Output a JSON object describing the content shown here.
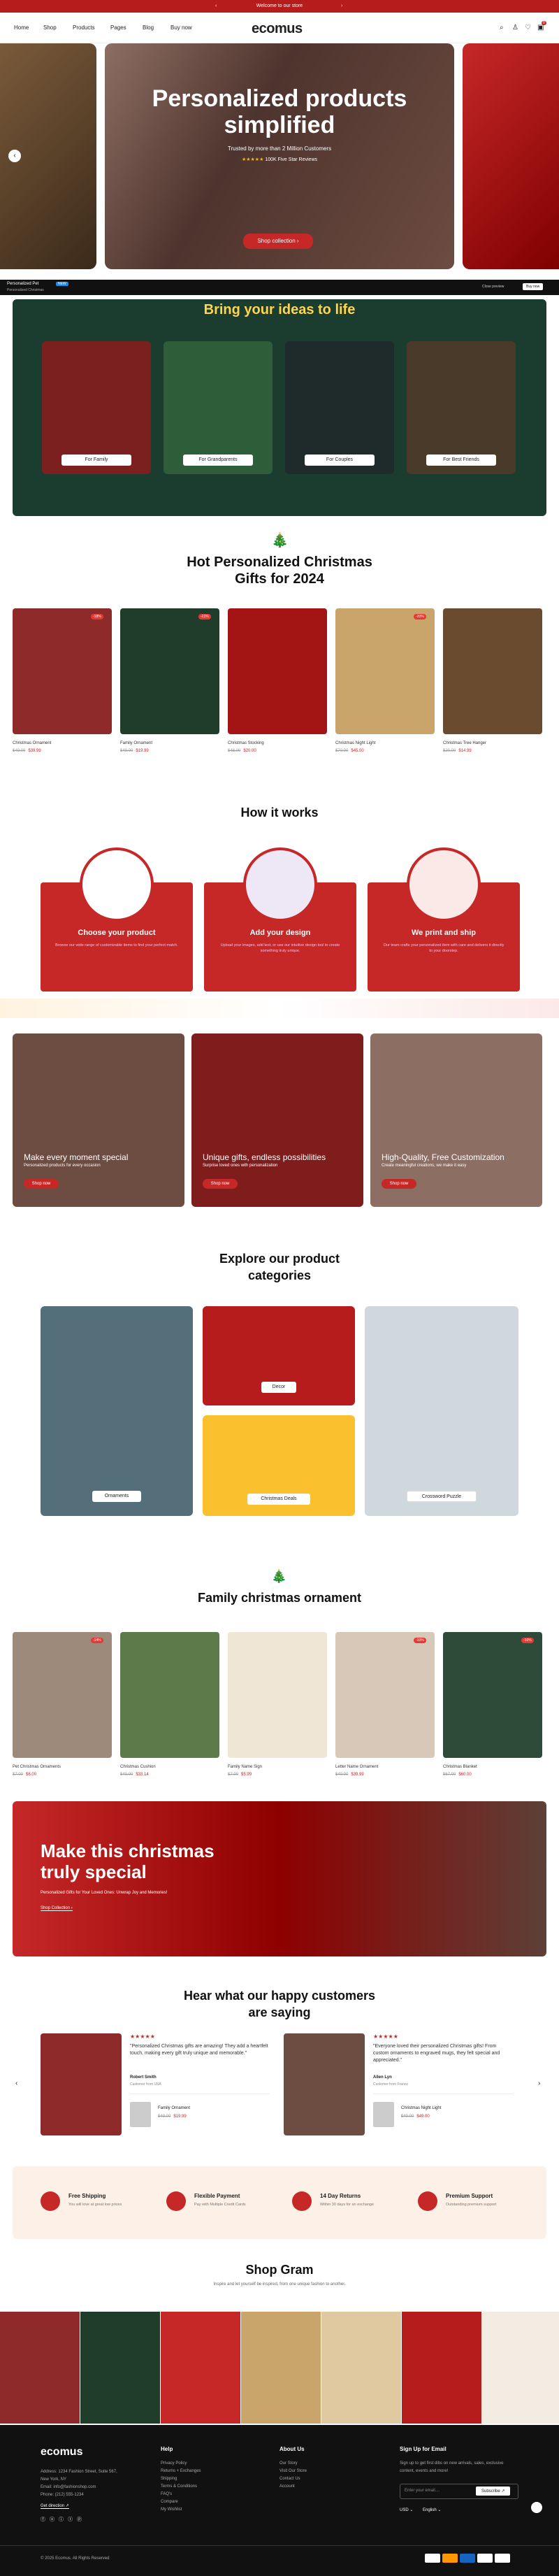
{
  "topbar": {
    "text": "Welcome to our store"
  },
  "nav": {
    "items": [
      "Home",
      "Shop",
      "Products",
      "Pages",
      "Blog",
      "Buy now"
    ],
    "logo": "ecomus",
    "cart_count": "0"
  },
  "hero": {
    "title_line1": "Personalized products",
    "title_line2": "simplified",
    "subtitle": "Trusted by more than 2 Million Customers",
    "rating": "★★★★★",
    "reviews": "100K Five Star Reviews",
    "button": "Shop collection"
  },
  "promo_bar": {
    "left_title": "Personalized Pet",
    "left_badge": "NEW",
    "left_sub": "Personalized Christmas",
    "btn1": "Close preview",
    "btn2": "Buy now"
  },
  "ideas": {
    "title": "Bring your ideas to life",
    "cards": [
      "For Family",
      "For Grandparents",
      "For Couples",
      "For Best Friends"
    ]
  },
  "hot": {
    "title_line1": "Hot Personalized Christmas",
    "title_line2": "Gifts for 2024",
    "products": [
      {
        "name": "Christmas Ornament",
        "old": "$49.00",
        "new": "$39.99",
        "badge": "-18%"
      },
      {
        "name": "Family Ornament",
        "old": "$49.00",
        "new": "$19.99",
        "badge": "-21%"
      },
      {
        "name": "Christmas Stocking",
        "old": "$48.00",
        "new": "$20.00",
        "badge": ""
      },
      {
        "name": "Christmas Night Light",
        "old": "$70.00",
        "new": "$45.00",
        "badge": "-20%"
      },
      {
        "name": "Christmas Tree Hanger",
        "old": "$20.00",
        "new": "$14.99",
        "badge": ""
      }
    ]
  },
  "how": {
    "title": "How it works",
    "steps": [
      {
        "title": "Choose your product",
        "desc": "Browse our wide range of customizable items to find your perfect match."
      },
      {
        "title": "Add your design",
        "desc": "Upload your images, add text, or use our intuitive design tool to create something truly unique."
      },
      {
        "title": "We print and ship",
        "desc": "Our team crafts your personalized item with care and delivers it directly to your doorstep."
      }
    ]
  },
  "banners": [
    {
      "title": "Make every moment special",
      "sub": "Personalized products for every occasion",
      "btn": "Shop now"
    },
    {
      "title": "Unique gifts, endless possibilities",
      "sub": "Surprise loved ones with personalization",
      "btn": "Shop now"
    },
    {
      "title": "High-Quality, Free Customization",
      "sub": "Create meaningful creations, we make it easy",
      "btn": "Shop now"
    }
  ],
  "categories": {
    "title_line1": "Explore our product",
    "title_line2": "categories",
    "items": [
      "Ornaments",
      "Decor",
      "Christmas Deals",
      "Crossword Puzzle"
    ]
  },
  "family": {
    "title": "Family christmas ornament",
    "products": [
      {
        "name": "Pet Christmas Ornaments",
        "old": "$7.00",
        "new": "$6.00",
        "badge": "-14%"
      },
      {
        "name": "Christmas Cushion",
        "old": "$40.00",
        "new": "$33.14",
        "badge": ""
      },
      {
        "name": "Family Name Sign",
        "old": "$7.00",
        "new": "$5.99",
        "badge": ""
      },
      {
        "name": "Letter Name Ornament",
        "old": "$40.00",
        "new": "$39.99",
        "badge": "-10%"
      },
      {
        "name": "Christmas Blanket",
        "old": "$67.00",
        "new": "$60.00",
        "badge": "-10%"
      }
    ]
  },
  "xmas_banner": {
    "title_line1": "Make this christmas",
    "title_line2": "truly special",
    "sub": "Personalized Gifts for Your Loved Ones: Unwrap Joy and Memories!",
    "btn": "Shop Collection"
  },
  "testimonials": {
    "title_line1": "Hear what our happy customers",
    "title_line2": "are saying",
    "items": [
      {
        "stars": "★★★★★",
        "text": "\"Personalized Christmas gifts are amazing! They add a heartfelt touch, making every gift truly unique and memorable.\"",
        "name": "Robert Smith",
        "role": "Customer from USA",
        "product": "Family Ornament",
        "old": "$49.00",
        "new": "$19.99"
      },
      {
        "stars": "★★★★★",
        "text": "\"Everyone loved their personalized Christmas gifts! From custom ornaments to engraved mugs, they felt special and appreciated.\"",
        "name": "Allen Lyn",
        "role": "Customer from France",
        "product": "Christmas Night Light",
        "old": "$49.00",
        "new": "$49.00"
      }
    ]
  },
  "features": [
    {
      "title": "Free Shipping",
      "sub": "You will love at great low prices"
    },
    {
      "title": "Flexible Payment",
      "sub": "Pay with Multiple Credit Cards"
    },
    {
      "title": "14 Day Returns",
      "sub": "Within 30 days for an exchange"
    },
    {
      "title": "Premium Support",
      "sub": "Outstanding premium support"
    }
  ],
  "shopgram": {
    "title": "Shop Gram",
    "sub": "Inspire and let yourself be inspired, from one unique fashion to another."
  },
  "footer": {
    "logo": "ecomus",
    "address": "Address: 1234 Fashion Street, Suite 567,",
    "city": "New York, NY",
    "email": "Email: info@fashionshop.com",
    "phone": "Phone: (212) 555-1234",
    "directions": "Get direction ↗",
    "help_title": "Help",
    "help_links": [
      "Privacy Policy",
      "Returns + Exchanges",
      "Shipping",
      "Terms & Conditions",
      "FAQ's",
      "Compare",
      "My Wishlist"
    ],
    "about_title": "About Us",
    "about_links": [
      "Our Story",
      "Visit Our Store",
      "Contact Us",
      "Account"
    ],
    "signup_title": "Sign Up for Email",
    "signup_text": "Sign up to get first dibs on new arrivals, sales, exclusive content, events and more!",
    "email_placeholder": "Enter your email....",
    "subscribe": "Subscribe",
    "currency": "USD",
    "language": "English",
    "copyright": "© 2025 Ecomus. All Rights Reserved"
  }
}
